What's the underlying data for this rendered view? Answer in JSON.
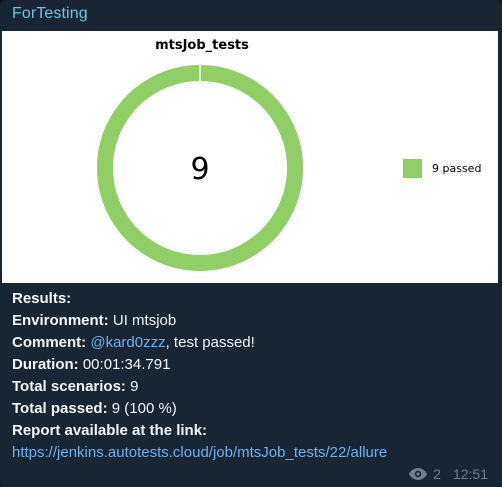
{
  "message": {
    "sender": "ForTesting",
    "sender_color": "#67c7e6",
    "views": "2",
    "time": "12:51"
  },
  "chart_data": {
    "type": "pie",
    "title": "mtsJob_tests",
    "center_label": "9",
    "slices": [
      {
        "label": "9 passed",
        "value": 9,
        "color": "#8fcf65"
      }
    ],
    "legend_position": "right"
  },
  "caption": {
    "results_label": "Results:",
    "environment_label": "Environment:",
    "environment_value": "UI mtsjob",
    "comment_label": "Comment:",
    "comment_mention": "@kard0zzz",
    "comment_text": ", test passed!",
    "duration_label": "Duration:",
    "duration_value": "00:01:34.791",
    "total_scenarios_label": "Total scenarios:",
    "total_scenarios_value": "9",
    "total_passed_label": "Total passed:",
    "total_passed_value": "9 (100 %)",
    "report_label": "Report available at the link:",
    "report_url": "https://jenkins.autotests.cloud/job/mtsJob_tests/22/allure"
  },
  "icons": {
    "views": "eye-icon"
  }
}
